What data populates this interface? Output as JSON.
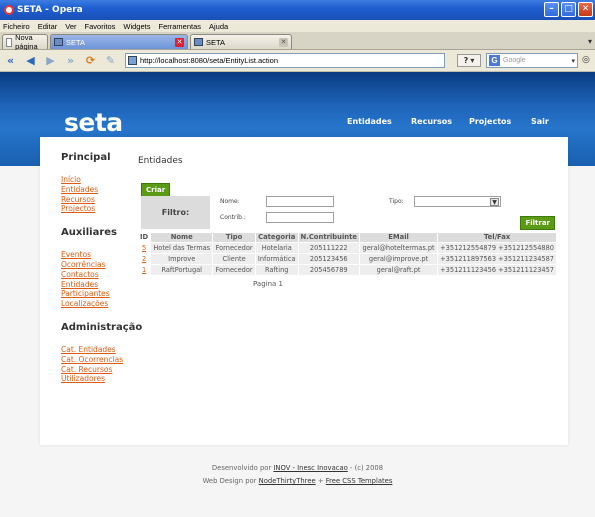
{
  "window": {
    "title": "SETA - Opera"
  },
  "menu": [
    "Ficheiro",
    "Editar",
    "Ver",
    "Favoritos",
    "Widgets",
    "Ferramentas",
    "Ajuda"
  ],
  "tabs": [
    {
      "label": "Nova página"
    },
    {
      "label": "SETA"
    },
    {
      "label": "SETA"
    }
  ],
  "address": {
    "url": "http://localhost:8080/seta/EntityList.action",
    "search_placeholder": "Google",
    "help": "?"
  },
  "site": {
    "logo": "seta",
    "nav": [
      "Entidades",
      "Recursos",
      "Projectos",
      "Sair"
    ]
  },
  "sidebar": {
    "principal": {
      "title": "Principal",
      "links": [
        "Início",
        "Entidades",
        "Recursos",
        "Projectos"
      ]
    },
    "auxiliares": {
      "title": "Auxiliares",
      "links": [
        "Eventos",
        "Ocorrências",
        "Contactos",
        "Entidades",
        "Participantes",
        "Localizações"
      ]
    },
    "administracao": {
      "title": "Administração",
      "links": [
        "Cat. Entidades",
        "Cat. Ocorrencias",
        "Cat. Recursos",
        "Utilizadores"
      ]
    }
  },
  "main": {
    "title": "Entidades",
    "criar": "Criar",
    "filter": {
      "label": "Filtro:",
      "nome": "Nome:",
      "contrib": "Contrib.:",
      "tipo": "Tipo:",
      "filtrar": "Filtrar"
    },
    "columns": [
      "ID",
      "Nome",
      "Tipo",
      "Categoria",
      "N.Contribuinte",
      "EMail",
      "Tel/Fax"
    ],
    "rows": [
      [
        "5",
        "Hotel das Termas",
        "Fornecedor",
        "Hotelaria",
        "205111222",
        "geral@hoteltermas.pt",
        "+351212554879 +351212554880"
      ],
      [
        "2",
        "Improve",
        "Cliente",
        "Informática",
        "205123456",
        "geral@improve.pt",
        "+351211897563 +351211234587"
      ],
      [
        "1",
        "RaftPortugal",
        "Fornecedor",
        "Rafting",
        "205456789",
        "geral@raft.pt",
        "+351211123456 +351211123457"
      ]
    ],
    "pagination": "Pagina 1"
  },
  "footer": {
    "line1_prefix": "Desenvolvido por ",
    "line1_link": "INOV - Inesc Inovacao",
    "line1_suffix": " - (c) 2008",
    "line2_prefix": "Web Design por ",
    "line2_link1": "NodeThirtyThree",
    "line2_mid": " + ",
    "line2_link2": "Free CSS Templates"
  }
}
